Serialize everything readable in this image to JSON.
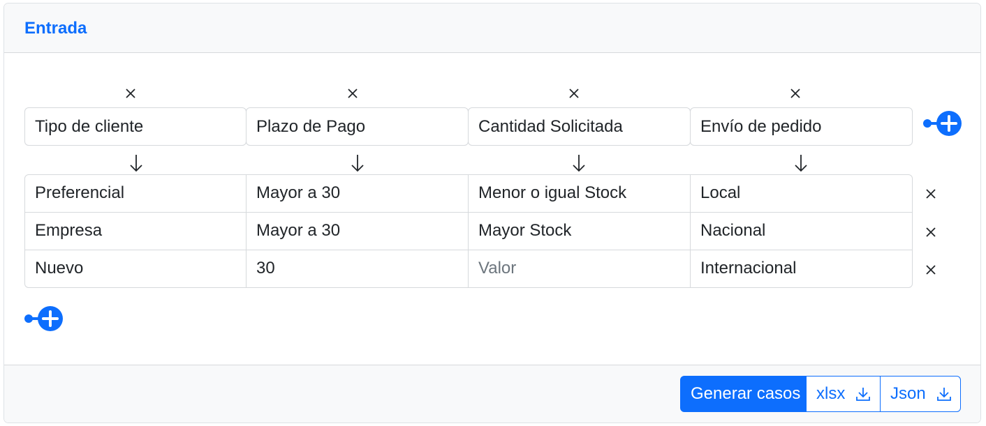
{
  "card": {
    "title": "Entrada"
  },
  "columns": [
    {
      "label": "Tipo de cliente"
    },
    {
      "label": "Plazo de Pago"
    },
    {
      "label": "Cantidad Solicitada"
    },
    {
      "label": "Envío de pedido"
    }
  ],
  "rows": [
    {
      "cells": [
        "Preferencial",
        "Mayor a 30",
        "Menor o igual Stock",
        "Local"
      ]
    },
    {
      "cells": [
        "Empresa",
        "Mayor a 30",
        "Mayor Stock",
        "Nacional"
      ]
    },
    {
      "cells": [
        "Nuevo",
        "30",
        "Valor",
        "Internacional"
      ]
    }
  ],
  "placeholder_value": "Valor",
  "footer": {
    "generate_label": "Generar casos",
    "xlsx_label": "xlsx",
    "json_label": "Json"
  },
  "icons": {
    "remove": "close-icon",
    "arrow": "arrow-down-icon",
    "add": "add-circle-icon",
    "download": "download-icon"
  },
  "colors": {
    "accent": "#0d6efd",
    "header_bg": "#f8f9fa",
    "border": "#d6d9dc",
    "text": "#212529",
    "placeholder": "#6c757d"
  }
}
